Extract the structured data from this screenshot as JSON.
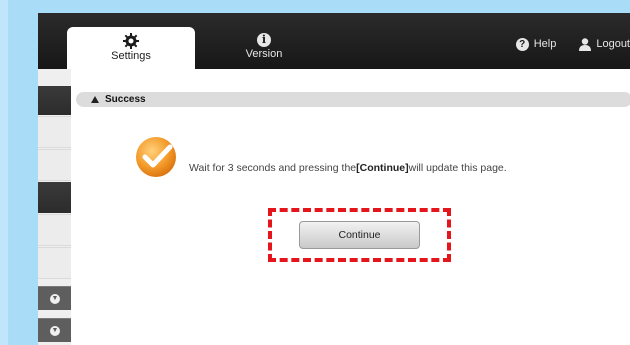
{
  "header": {
    "tabs": [
      {
        "label": "Settings",
        "icon": "gear-icon",
        "active": true
      },
      {
        "label": "Version",
        "icon": "info-icon",
        "active": false
      }
    ],
    "help_label": "Help",
    "logout_label": "Logout"
  },
  "status": {
    "title": "Success",
    "icon": "warning-icon"
  },
  "message": {
    "prefix": "Wait for 3 seconds and pressing the",
    "emphasis": "[Continue]",
    "suffix": "will update this page."
  },
  "continue_label": "Continue",
  "colors": {
    "accent_highlight": "#e4151b",
    "header_bg": "#1f1f1f",
    "success_check": "#f08a1c",
    "frame_bg": "#a9dcf7"
  }
}
